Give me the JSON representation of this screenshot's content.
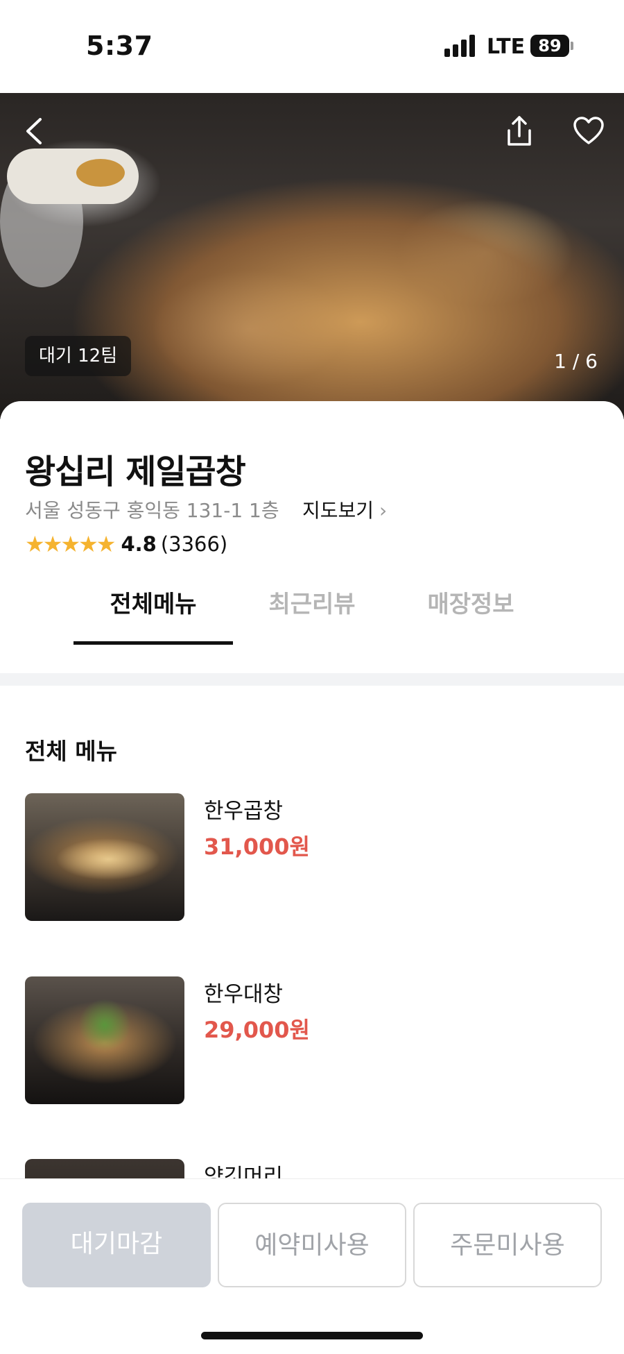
{
  "status_bar": {
    "time": "5:37",
    "network": "LTE",
    "battery": "89"
  },
  "hero": {
    "wait_badge": "대기 12팀",
    "page_counter": "1 / 6"
  },
  "store": {
    "name": "왕십리 제일곱창",
    "address": "서울 성동구 홍익동 131-1 1층",
    "map_link": "지도보기",
    "stars": "★★★★★",
    "rating": "4.8",
    "review_count": "(3366)"
  },
  "tabs": [
    {
      "label": "전체메뉴",
      "active": true
    },
    {
      "label": "최근리뷰",
      "active": false
    },
    {
      "label": "매장정보",
      "active": false
    }
  ],
  "menu": {
    "section_title": "전체 메뉴",
    "items": [
      {
        "name": "한우곱창",
        "price": "31,000원"
      },
      {
        "name": "한우대창",
        "price": "29,000원"
      },
      {
        "name": "양깃머리",
        "price": ""
      }
    ]
  },
  "actions": {
    "wait": "대기마감",
    "reserve": "예약미사용",
    "order": "주문미사용"
  },
  "colors": {
    "price": "#e2574c",
    "star": "#f5b32f",
    "disabled_button": "#cfd3da"
  }
}
